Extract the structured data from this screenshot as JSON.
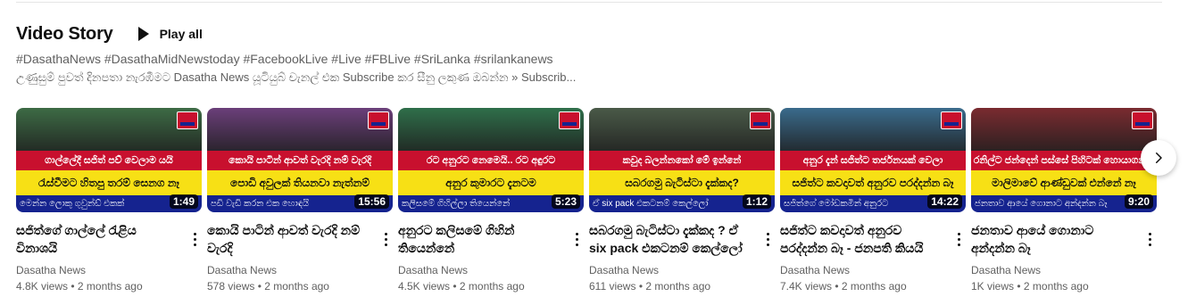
{
  "shelf": {
    "title": "Video Story",
    "play_all_label": "Play all",
    "hashtags": "#DasathaNews #DasathaMidNewstoday #FacebookLive #Live #FBLive #SriLanka #srilankanews",
    "description": "උණුසුම් පුවත් දිනපතා නැරඹීමට Dasatha News යූටියුබ් චැනල් එක Subscribe කර සීනු ලකුණ ඔබන්න » Subscrib..."
  },
  "videos": [
    {
      "title": "සජිත්ගේ ගාල්ලේ රැළිය විනාශයි",
      "channel": "Dasatha News",
      "views": "4.8K views",
      "age": "2 months ago",
      "duration": "1:49",
      "thumb_line1": "ගාල්ලේදී සජිත් පව් වෙලාම යයි",
      "thumb_line2": "රැස්වීමට හිතපු තරම් සෙනග නෑ",
      "thumb_line3": "මෙන්න ලොකු ගුවුන්ඩ් එකක්",
      "scene_color": "#3d6b45"
    },
    {
      "title": "කොයි පාටින් ආවත් වැරදි නම් වැරදි",
      "channel": "Dasatha News",
      "views": "578 views",
      "age": "2 months ago",
      "duration": "15:56",
      "thumb_line1": "කොයි පාටින් ආවත් වැරදි නම් වැරදි",
      "thumb_line2": "පොඩි අවුලක් තියනවා නැත්නම්",
      "thumb_line3": "පඩි වැඩි කරන එක හොඳයි",
      "scene_color": "#6b3f7a"
    },
    {
      "title": "අනුරට කලිසමේ ගිහින් තියෙන්නේ",
      "channel": "Dasatha News",
      "views": "4.5K views",
      "age": "2 months ago",
      "duration": "5:23",
      "thumb_line1": "රට අනුරට නෙමෙයි.. රට අඳුරට",
      "thumb_line2": "අනුර කුමාරට දැනටම",
      "thumb_line3": "කලිසමේ ගිහිල්ලා තියෙන්නේ",
      "scene_color": "#2f6f4a"
    },
    {
      "title": "සබරගමු බැටිස්ටා දැක්කද ? ඒ six pack එකටනම් කෙල්ලෝ පිස්සු...",
      "channel": "Dasatha News",
      "views": "611 views",
      "age": "2 months ago",
      "duration": "1:12",
      "thumb_line1": "කවුද බලන්නකෝ මේ ඉන්නේ",
      "thumb_line2": "සබරගමු බැටිස්ටා දැක්කද?",
      "thumb_line3": "ඒ six pack එකටනම් කෙල්ලෝ",
      "scene_color": "#4a5a48"
    },
    {
      "title": "සජිත්ට කවදාවත් අනුරව පරද්දන්න බෑ - ජනපති කියයි",
      "channel": "Dasatha News",
      "views": "7.4K views",
      "age": "2 months ago",
      "duration": "14:22",
      "thumb_line1": "අනුර දැන් සජිත්ට තර්ජනයක් වෙලා",
      "thumb_line2": "සජිත්ට කවදාවත් අනුරව පරද්දන්න බෑ",
      "thumb_line3": "සජිත්ගේ මෝඩකමින් අනුරට",
      "scene_color": "#3a6b8c"
    },
    {
      "title": "ජනතාව ආයේ ගොනාට අන්දන්න බෑ",
      "channel": "Dasatha News",
      "views": "1K views",
      "age": "2 months ago",
      "duration": "9:20",
      "thumb_line1": "රනිල්ට ජන්දෙන් පස්සේ පිහිටක් හොයාගන්න",
      "thumb_line2": "මාලිමාවේ ආණ්ඩුවක් එන්නේ නෑ",
      "thumb_line3": "ජනතාව ආයේ ගොනාට අන්දන්න බෑ",
      "scene_color": "#7a2b30"
    }
  ],
  "icons": {
    "play": "play-icon",
    "menu": "more-vert-icon",
    "next": "chevron-right-icon"
  },
  "colors": {
    "thumb_red": "#c8102e",
    "thumb_yellow": "#f7e015",
    "thumb_blue": "#15238f",
    "secondary_text": "#606060"
  }
}
